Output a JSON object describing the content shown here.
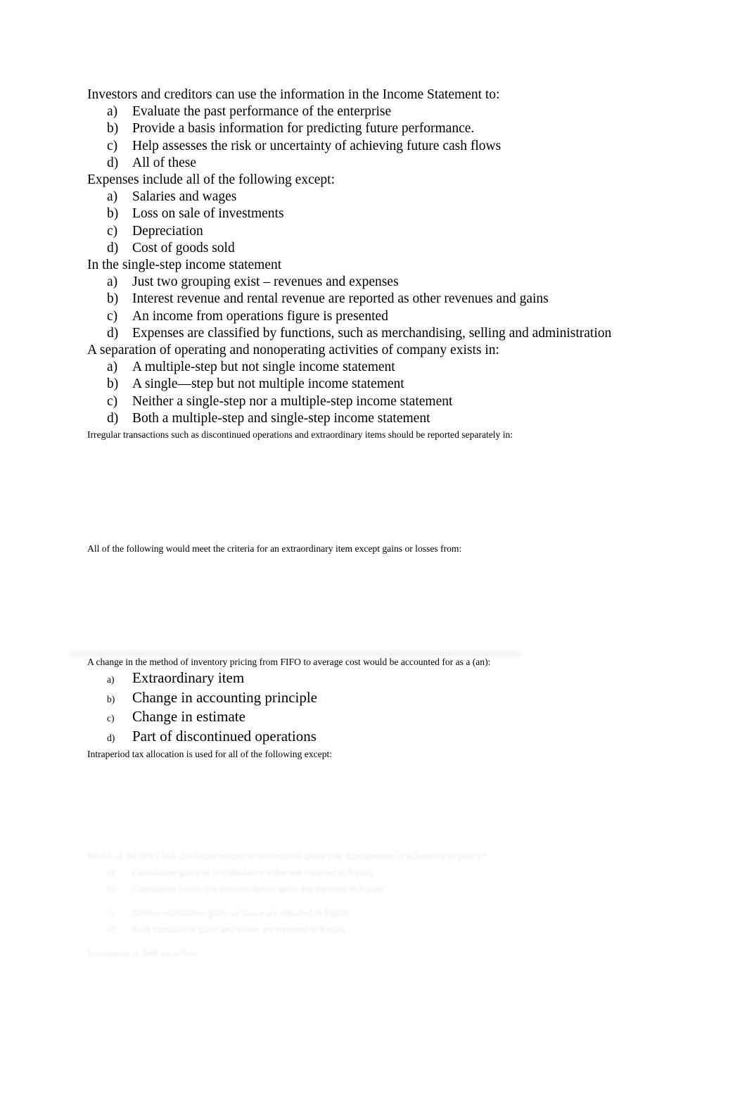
{
  "document": {
    "background_color": "#ffffff",
    "text_color": "#000000",
    "blocks": [
      {
        "id": "income-statement-use",
        "style": "large",
        "question": "Investors and creditors can use the information in the Income Statement to:",
        "options": [
          {
            "marker": "a)",
            "text": "Evaluate the past performance of the enterprise"
          },
          {
            "marker": "b)",
            "text": "Provide a basis information for predicting future performance."
          },
          {
            "marker": "c)",
            "text": "Help assesses the risk or uncertainty of achieving future cash flows"
          },
          {
            "marker": "d)",
            "text": "All of these"
          }
        ]
      },
      {
        "id": "expenses-include",
        "style": "large",
        "question": "Expenses include all of the following except:",
        "options": [
          {
            "marker": "a)",
            "text": "Salaries and wages"
          },
          {
            "marker": "b)",
            "text": "Loss on sale of investments"
          },
          {
            "marker": "c)",
            "text": "Depreciation"
          },
          {
            "marker": "d)",
            "text": "Cost of goods sold"
          }
        ]
      },
      {
        "id": "single-step-income-statement",
        "style": "large",
        "question": "In the single-step income statement",
        "options": [
          {
            "marker": "a)",
            "text": "Just two grouping exist – revenues and expenses"
          },
          {
            "marker": "b)",
            "text": "Interest revenue and rental revenue are reported as other revenues and gains"
          },
          {
            "marker": "c)",
            "text": "An income from operations figure is presented"
          },
          {
            "marker": "d)",
            "text": "Expenses are classified by functions, such as merchandising, selling and administration"
          }
        ]
      },
      {
        "id": "separation-operating-nonoperating",
        "style": "large",
        "question": "A separation of operating and nonoperating activities of company exists in:",
        "options": [
          {
            "marker": "a)",
            "text": "A multiple-step but not single income statement"
          },
          {
            "marker": "b)",
            "text": "A single—step but not multiple income statement"
          },
          {
            "marker": "c)",
            "text": "Neither a single-step nor a multiple-step income statement"
          },
          {
            "marker": "d)",
            "text": "Both a multiple-step and single-step income statement"
          }
        ]
      },
      {
        "id": "irregular-transactions",
        "style": "small",
        "question": "Irregular transactions such as discontinued operations and extraordinary items should be reported separately in:",
        "options": []
      },
      {
        "id": "extraordinary-item-criteria",
        "style": "small",
        "question": "All of the following would meet the criteria for an extraordinary item except gains or losses from:",
        "options": []
      },
      {
        "id": "fifo-to-average-cost",
        "style": "mixed",
        "question": "A change in the method of inventory pricing from FIFO to average cost would be accounted for as a (an):",
        "options": [
          {
            "marker": "a)",
            "text": "Extraordinary item"
          },
          {
            "marker": "b)",
            "text": "Change in accounting principle"
          },
          {
            "marker": "c)",
            "text": "Change in estimate"
          },
          {
            "marker": "d)",
            "text": "Part of discontinued operations"
          }
        ]
      },
      {
        "id": "intraperiod-tax-allocation",
        "style": "small",
        "question": "Intraperiod tax allocation is used for all of the following except:",
        "options": []
      }
    ],
    "faded_block": {
      "id": "faded-illegible-question",
      "note_visible": false,
      "question": "Which of the IFRS risk disclosure relates to information about risk management or adherence to policy?",
      "options": [
        {
          "marker": "a)",
          "text": "Cumulative gains or in cumulative value are reported in Equity"
        },
        {
          "marker": "b)",
          "text": "Cumulative losses but not cumulative gains are reported in Equity"
        },
        {
          "marker": "c)",
          "text": "Neither cumulative gains or losses are reported in Equity"
        },
        {
          "marker": "d)",
          "text": "Both cumulative gains and losses are reported in Equity"
        }
      ],
      "trailing": "Investment in debt securities"
    }
  }
}
